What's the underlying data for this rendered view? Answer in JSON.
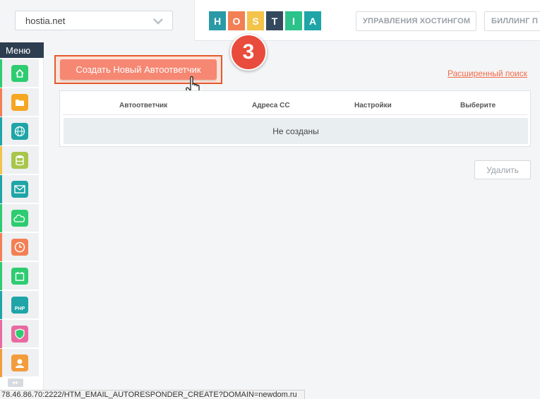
{
  "header": {
    "domain_select": {
      "value": "hostia.net"
    },
    "logo_letters": [
      {
        "letter": "H",
        "color": "#2a9aa6"
      },
      {
        "letter": "O",
        "color": "#f37f54"
      },
      {
        "letter": "S",
        "color": "#f3c34a"
      },
      {
        "letter": "T",
        "color": "#34495e"
      },
      {
        "letter": "I",
        "color": "#2cc38b"
      },
      {
        "letter": "A",
        "color": "#1fa5a7"
      }
    ],
    "nav": [
      {
        "label": "УПРАВЛЕНИЯ ХОСТИНГОМ"
      },
      {
        "label": "БИЛЛИНГ П"
      }
    ]
  },
  "sidebar": {
    "menu_label": "Меню",
    "items": [
      {
        "icon": "home-icon",
        "color": "#2ecc71",
        "accent": "#2ecc71"
      },
      {
        "icon": "folder-icon",
        "color": "#f5a623",
        "accent": "#f37f54"
      },
      {
        "icon": "globe-www-icon",
        "color": "#1fa5a7",
        "accent": "#1fa5a7"
      },
      {
        "icon": "database-icon",
        "color": "#a8c64a",
        "accent": "#f3c34a"
      },
      {
        "icon": "mail-icon",
        "color": "#1fa5a7",
        "accent": "#1fa5a7"
      },
      {
        "icon": "ftp-cloud-icon",
        "color": "#2ecc71",
        "accent": "#2ecc71"
      },
      {
        "icon": "clock-icon",
        "color": "#f37f54",
        "accent": "#f37f54"
      },
      {
        "icon": "calendar-icon",
        "color": "#2ecc71",
        "accent": "#2ecc71"
      },
      {
        "icon": "php-icon",
        "color": "#1fa5a7",
        "accent": "#1fa5a7",
        "text": "PHP"
      },
      {
        "icon": "shield-icon",
        "color": "#e86aa0",
        "accent": "#e86aa0"
      },
      {
        "icon": "user-support-icon",
        "color": "#f39c3c",
        "accent": "#f39c3c"
      }
    ]
  },
  "main": {
    "create_button": "Создать Новый Автоответчик",
    "step_badge": "3",
    "advanced_search": "Расширенный поиск",
    "table": {
      "columns": [
        "Автоответчик",
        "Адреса СС",
        "Настройки",
        "Выберите"
      ],
      "empty_text": "Не созданы"
    },
    "delete_button": "Удалить"
  },
  "statusbar": {
    "url": "78.46.86.70:2222/HTM_EMAIL_AUTORESPONDER_CREATE?DOMAIN=newdom.ru"
  }
}
